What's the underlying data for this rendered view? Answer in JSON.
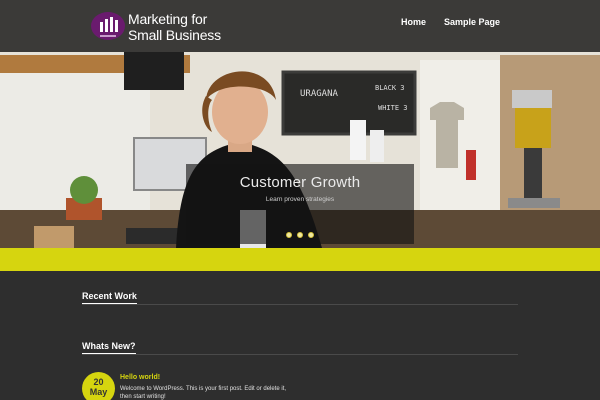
{
  "site": {
    "title_line1": "Marketing for",
    "title_line2": "Small Business"
  },
  "nav": {
    "items": [
      "Home",
      "Sample Page"
    ]
  },
  "slider": {
    "caption_title": "Customer Growth",
    "caption_subtitle": "Learn proven strategies",
    "dots_count": 3
  },
  "sections": {
    "recent_work": "Recent Work",
    "whats_new": "Whats New?"
  },
  "post": {
    "day": "20",
    "month": "May",
    "title": "Hello world!",
    "excerpt": "Welcome to WordPress. This is your first post. Edit or delete it, then start writing!"
  },
  "colors": {
    "accent": "#d6d50f",
    "header_bg": "#0a0a0a",
    "content_bg": "#2e2e2e",
    "logo_purple": "#6a1b6e"
  }
}
